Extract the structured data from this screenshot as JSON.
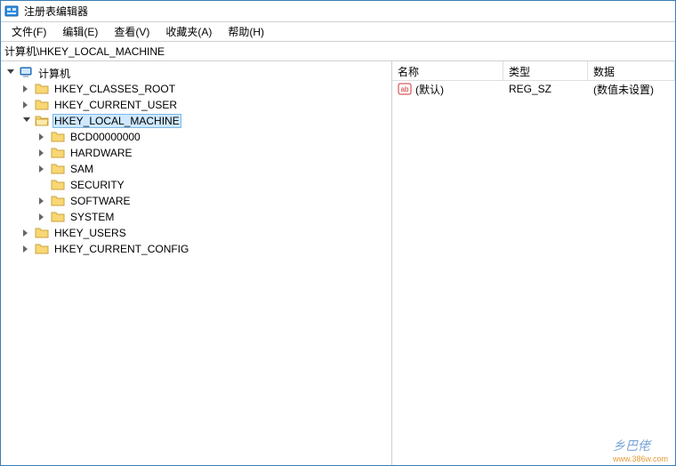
{
  "window": {
    "title": "注册表编辑器"
  },
  "menu": {
    "file": "文件(F)",
    "edit": "编辑(E)",
    "view": "查看(V)",
    "fav": "收藏夹(A)",
    "help": "帮助(H)"
  },
  "address": {
    "value": "计算机\\HKEY_LOCAL_MACHINE"
  },
  "tree": {
    "root": "计算机",
    "hives": {
      "hkcr": "HKEY_CLASSES_ROOT",
      "hkcu": "HKEY_CURRENT_USER",
      "hklm": "HKEY_LOCAL_MACHINE",
      "hku": "HKEY_USERS",
      "hkcc": "HKEY_CURRENT_CONFIG"
    },
    "hklm_children": {
      "bcd": "BCD00000000",
      "hardware": "HARDWARE",
      "sam": "SAM",
      "security": "SECURITY",
      "software": "SOFTWARE",
      "system": "SYSTEM"
    }
  },
  "list": {
    "headers": {
      "name": "名称",
      "type": "类型",
      "data": "数据"
    },
    "rows": [
      {
        "name": "(默认)",
        "type": "REG_SZ",
        "data": "(数值未设置)"
      }
    ]
  },
  "watermark": {
    "text": "乡巴佬",
    "url": "www.386w.com"
  }
}
